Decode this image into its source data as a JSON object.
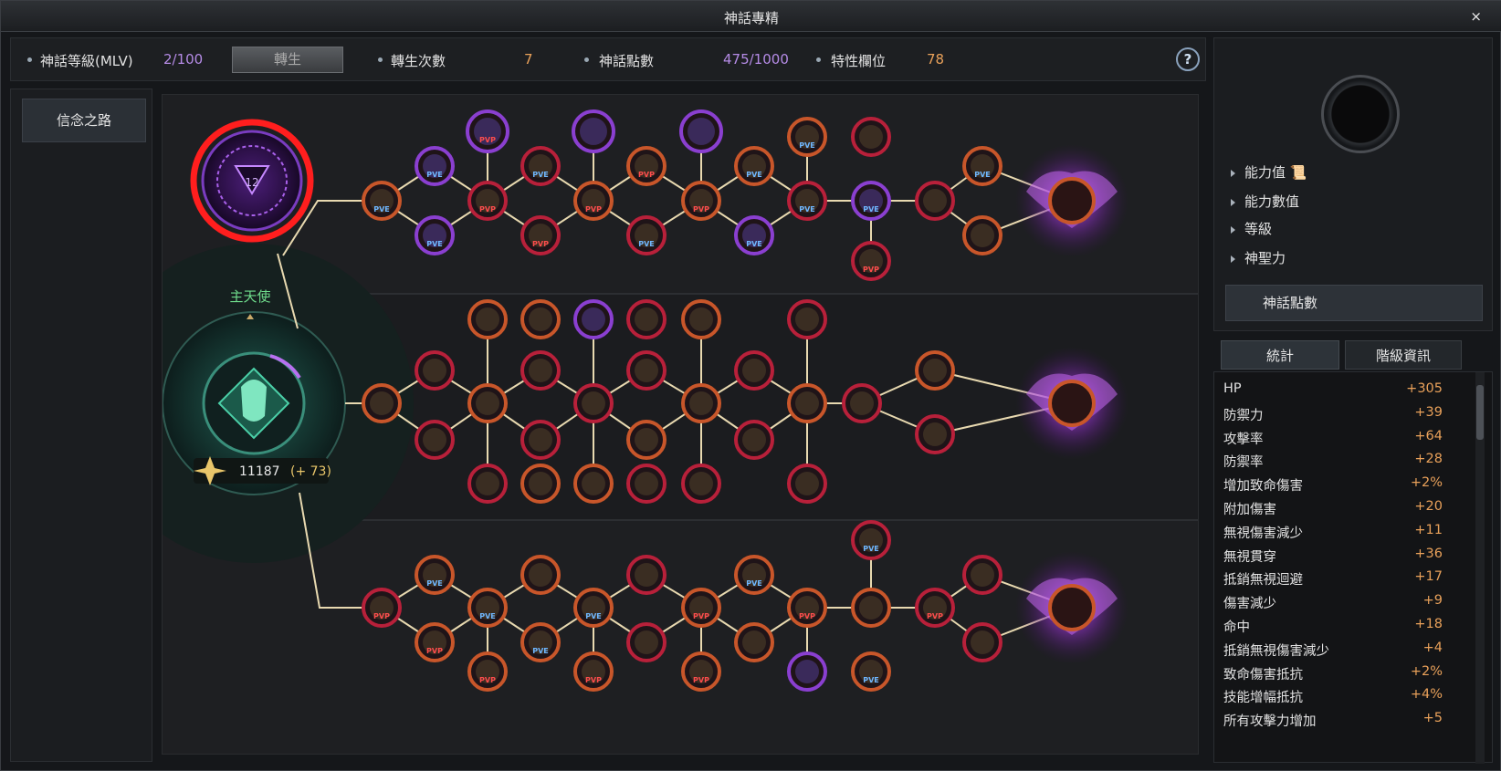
{
  "window": {
    "title": "神話專精",
    "close": "×"
  },
  "topbar": {
    "mlv_label": "神話等級(MLV)",
    "mlv_value": "2/100",
    "rebirth_button": "轉生",
    "rebirth_count_label": "轉生次數",
    "rebirth_count_value": "7",
    "myth_points_label": "神話點數",
    "myth_points_value": "475/1000",
    "trait_slots_label": "特性欄位",
    "trait_slots_value": "78",
    "help": "?"
  },
  "sidebar": {
    "items": [
      {
        "label": "信念之路"
      }
    ]
  },
  "tree": {
    "emblem_level": "12",
    "class_name": "主天使",
    "power_value": "11187",
    "power_bonus": "(+ 73)",
    "node_tag_pvp": "PVP",
    "node_tag_pve": "PVE",
    "colors": {
      "red_ring": "#ff1e1e",
      "purple": "#8a3fd0",
      "orange": "#c8562a",
      "crimson": "#b8203a",
      "line": "#e8d9b0"
    }
  },
  "rightpanel": {
    "lines": [
      {
        "label": "能力值"
      },
      {
        "label": "能力數值"
      },
      {
        "label": "等級"
      },
      {
        "label": "神聖力"
      }
    ],
    "button": "神話點數",
    "tabs": [
      {
        "label": "統計"
      },
      {
        "label": "階級資訊"
      }
    ],
    "stats": [
      {
        "label": "HP",
        "value": "+305"
      },
      {
        "label": "防禦力",
        "value": "+39"
      },
      {
        "label": "攻擊率",
        "value": "+64"
      },
      {
        "label": "防禦率",
        "value": "+28"
      },
      {
        "label": "增加致命傷害",
        "value": "+2%"
      },
      {
        "label": "附加傷害",
        "value": "+20"
      },
      {
        "label": "無視傷害減少",
        "value": "+11"
      },
      {
        "label": "無視貫穿",
        "value": "+36"
      },
      {
        "label": "抵銷無視迴避",
        "value": "+17"
      },
      {
        "label": "傷害減少",
        "value": "+9"
      },
      {
        "label": "命中",
        "value": "+18"
      },
      {
        "label": "抵銷無視傷害減少",
        "value": "+4"
      },
      {
        "label": "致命傷害抵抗",
        "value": "+2%"
      },
      {
        "label": "技能增幅抵抗",
        "value": "+4%"
      },
      {
        "label": "所有攻擊力增加",
        "value": "+5"
      }
    ]
  }
}
